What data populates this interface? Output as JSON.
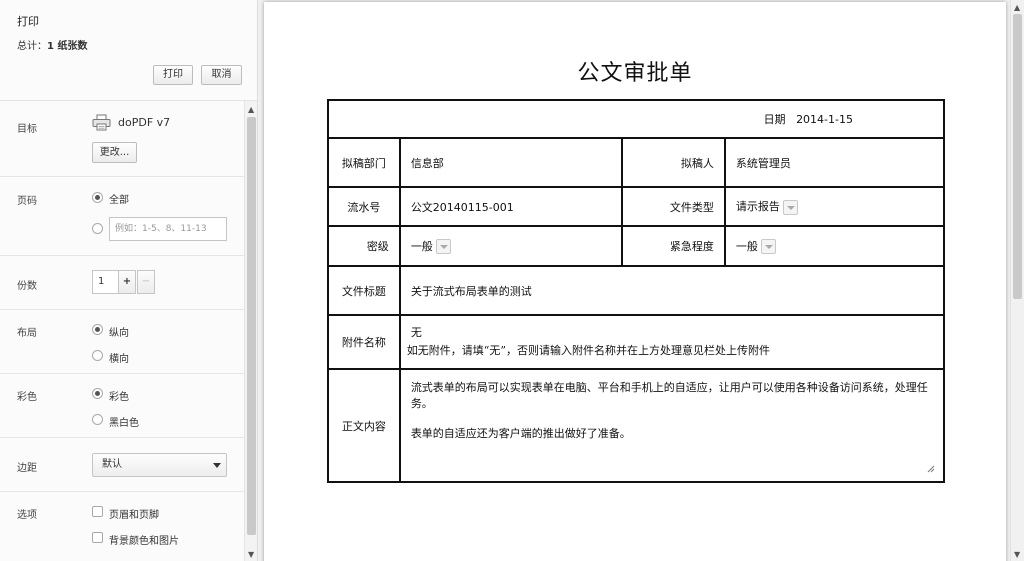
{
  "sidebar": {
    "title": "打印",
    "total_prefix": "总计：",
    "total_value": "1 纸张数",
    "print_button": "打印",
    "cancel_button": "取消",
    "destination": {
      "label": "目标",
      "printer": "doPDF v7",
      "change_button": "更改..."
    },
    "pages": {
      "label": "页码",
      "all_option": "全部",
      "range_placeholder": "例如：1-5、8、11-13"
    },
    "copies": {
      "label": "份数",
      "value": "1",
      "plus": "+",
      "minus": "−"
    },
    "layout": {
      "label": "布局",
      "portrait": "纵向",
      "landscape": "横向"
    },
    "color": {
      "label": "彩色",
      "color_option": "彩色",
      "bw_option": "黑白色"
    },
    "margins": {
      "label": "边距",
      "value": "默认"
    },
    "options": {
      "label": "选项",
      "headers_footers": "页眉和页脚",
      "background": "背景颜色和图片"
    }
  },
  "document": {
    "title": "公文审批单",
    "date_label": "日期",
    "date_value": "2014-1-15",
    "draft_dept_label": "拟稿部门",
    "draft_dept_value": "信息部",
    "drafter_label": "拟稿人",
    "drafter_value": "系统管理员",
    "serial_label": "流水号",
    "serial_value": "公文20140115-001",
    "doc_type_label": "文件类型",
    "doc_type_value": "请示报告",
    "secrecy_label": "密级",
    "secrecy_value": "一般",
    "urgency_label": "紧急程度",
    "urgency_value": "一般",
    "file_title_label": "文件标题",
    "file_title_value": "关于流式布局表单的测试",
    "attachment_label": "附件名称",
    "attachment_value": "无",
    "attachment_hint": "如无附件，请填“无”，否则请输入附件名称并在上方处理意见栏处上传附件",
    "body_label": "正文内容",
    "body_line1": "流式表单的布局可以实现表单在电脑、平台和手机上的自适应，让用户可以使用各种设备访问系统，处理任务。",
    "body_line2": "表单的自适应还为客户端的推出做好了准备。"
  },
  "icons": {
    "printer": "printer-icon",
    "scroll_up": "▲",
    "scroll_down": "▼"
  },
  "colors": {
    "sidebar_bg": "#fbfbfb",
    "preview_bg": "#f1f1f1",
    "table_border": "#111111"
  }
}
